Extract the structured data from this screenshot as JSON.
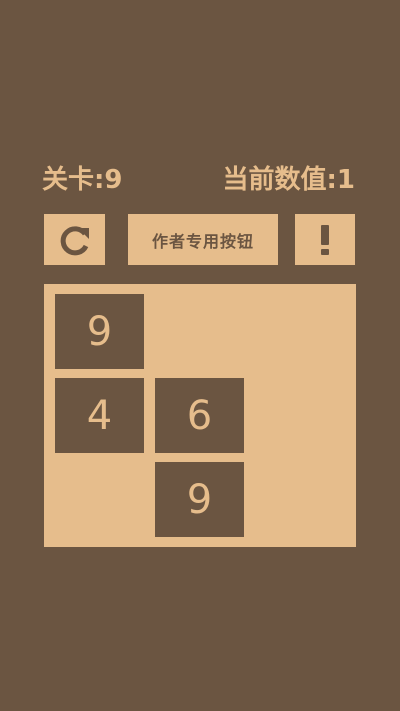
{
  "status": {
    "level_text": "关卡:9",
    "current_value_text": "当前数值:1"
  },
  "toolbar": {
    "restart_icon": "restart-icon",
    "author_label": "作者专用按钮",
    "help_icon": "exclamation-icon"
  },
  "board": {
    "tiles": [
      {
        "row": 0,
        "col": 0,
        "value": "9"
      },
      {
        "row": 1,
        "col": 0,
        "value": "4"
      },
      {
        "row": 1,
        "col": 1,
        "value": "6"
      },
      {
        "row": 2,
        "col": 1,
        "value": "9"
      }
    ]
  },
  "colors": {
    "background": "#6b5541",
    "accent": "#e6bd8c"
  }
}
